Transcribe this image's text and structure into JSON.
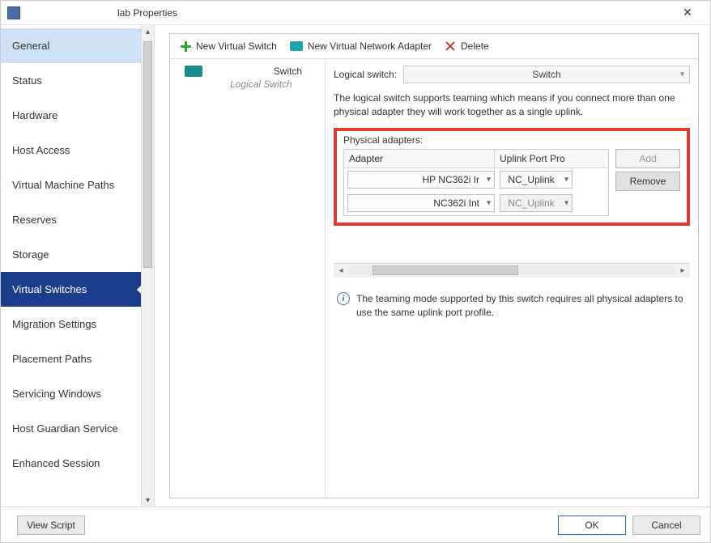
{
  "window": {
    "title": "lab Properties"
  },
  "sidebar": {
    "items": [
      {
        "label": "General"
      },
      {
        "label": "Status"
      },
      {
        "label": "Hardware"
      },
      {
        "label": "Host Access"
      },
      {
        "label": "Virtual Machine Paths"
      },
      {
        "label": "Reserves"
      },
      {
        "label": "Storage"
      },
      {
        "label": "Virtual Switches"
      },
      {
        "label": "Migration Settings"
      },
      {
        "label": "Placement Paths"
      },
      {
        "label": "Servicing Windows"
      },
      {
        "label": "Host Guardian Service"
      },
      {
        "label": "Enhanced Session"
      }
    ]
  },
  "toolbar": {
    "new_switch": "New Virtual Switch",
    "new_adapter": "New Virtual Network Adapter",
    "delete": "Delete"
  },
  "switch_list": {
    "entries": [
      {
        "name": "Switch",
        "subtitle": "Logical Switch"
      }
    ]
  },
  "detail": {
    "logical_label": "Logical switch:",
    "logical_value": "Switch",
    "desc": "The logical switch supports teaming which means if you connect more than one physical adapter they will work together as a single uplink.",
    "phys_label": "Physical adapters:",
    "grid": {
      "col_adapter": "Adapter",
      "col_uplink": "Uplink Port Pro",
      "rows": [
        {
          "adapter": "HP NC362i Ir",
          "profile": "NC_Uplink",
          "profile_enabled": true
        },
        {
          "adapter": "NC362i Int",
          "profile": "NC_Uplink",
          "profile_enabled": false
        }
      ]
    },
    "btn_add": "Add",
    "btn_remove": "Remove",
    "info": "The teaming mode supported by this switch requires all physical adapters to use the same uplink port profile."
  },
  "footer": {
    "view_script": "View Script",
    "ok": "OK",
    "cancel": "Cancel"
  }
}
